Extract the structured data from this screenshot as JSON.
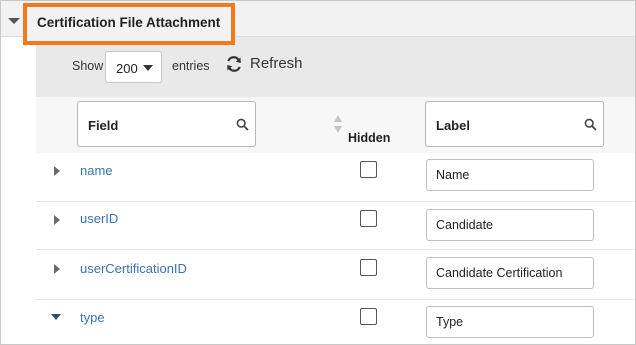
{
  "section": {
    "title": "Certification File Attachment"
  },
  "toolbar": {
    "show_label": "Show",
    "entries_value": "200",
    "entries_label": "entries",
    "refresh_label": "Refresh"
  },
  "table": {
    "headers": {
      "field": "Field",
      "hidden": "Hidden",
      "label": "Label"
    },
    "rows": [
      {
        "field": "name",
        "label": "Name",
        "hidden": false,
        "expanded": false
      },
      {
        "field": "userID",
        "label": "Candidate",
        "hidden": false,
        "expanded": false
      },
      {
        "field": "userCertificationID",
        "label": "Candidate Certification",
        "hidden": false,
        "expanded": false
      },
      {
        "field": "type",
        "label": "Type",
        "hidden": false,
        "expanded": true
      }
    ]
  },
  "colors": {
    "highlight": "#f07a1c",
    "link": "#3b73b0",
    "toolbar_bg": "#e9e9e9"
  },
  "icons": [
    "collapse-arrow-icon",
    "chevron-down-icon",
    "refresh-icon",
    "search-icon",
    "sort-icon",
    "expand-arrow-icon"
  ]
}
